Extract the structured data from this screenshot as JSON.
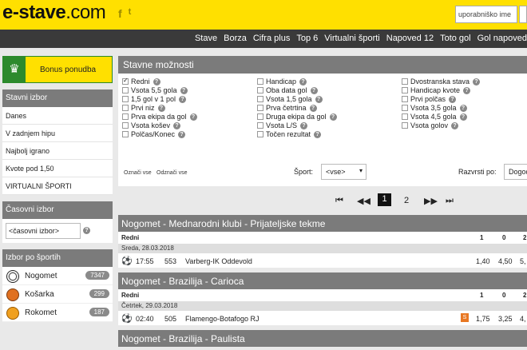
{
  "header": {
    "logo_main": "e-stave",
    "logo_domain": ".com",
    "social": [
      "f",
      "🐦"
    ],
    "login_placeholder": "uporabniško ime"
  },
  "nav": [
    "Stave",
    "Borza",
    "Cifra plus",
    "Top 6",
    "Virtualni športi",
    "Napoved 12",
    "Toto gol",
    "Gol napoved"
  ],
  "sidebar": {
    "bonus_label": "Bonus ponudba",
    "stavni_izbor_title": "Stavni izbor",
    "stavni_items": [
      "Danes",
      "V zadnjem hipu",
      "Najbolj igrano",
      "Kvote pod 1,50",
      "VIRTUALNI ŠPORTI"
    ],
    "casovni_title": "Časovni izbor",
    "casovni_value": "<časovni izbor>",
    "sport_title": "Izbor po športih",
    "sports": [
      {
        "name": "Nogomet",
        "count": "7347",
        "color": "#ffffff"
      },
      {
        "name": "Košarka",
        "count": "299",
        "color": "#e07020"
      },
      {
        "name": "Rokomet",
        "count": "187",
        "color": "#f0a020"
      }
    ]
  },
  "options": {
    "title": "Stavne možnosti",
    "col1": [
      {
        "label": "Redni",
        "checked": true
      },
      {
        "label": "Vsota 5,5 gola",
        "checked": false
      },
      {
        "label": "1,5 gol v 1 pol",
        "checked": false
      },
      {
        "label": "Prvi niz",
        "checked": false
      },
      {
        "label": "Prva ekipa da gol",
        "checked": false
      },
      {
        "label": "Vsota košev",
        "checked": false
      },
      {
        "label": "Polčas/Konec",
        "checked": false
      }
    ],
    "col2": [
      {
        "label": "Handicap",
        "checked": false
      },
      {
        "label": "Oba data gol",
        "checked": false
      },
      {
        "label": "Vsota 1,5 gola",
        "checked": false
      },
      {
        "label": "Prva četrtina",
        "checked": false
      },
      {
        "label": "Druga ekipa da gol",
        "checked": false
      },
      {
        "label": "Vsota L/S",
        "checked": false
      },
      {
        "label": "Točen rezultat",
        "checked": false
      }
    ],
    "col3": [
      {
        "label": "Dvostranska stava",
        "checked": false
      },
      {
        "label": "Handicap kvote",
        "checked": false
      },
      {
        "label": "Prvi polčas",
        "checked": false
      },
      {
        "label": "Vsota 3,5 gola",
        "checked": false
      },
      {
        "label": "Vsota 4,5 gola",
        "checked": false
      },
      {
        "label": "Vsota golov",
        "checked": false
      }
    ],
    "select_all": "Označi vse",
    "deselect_all": "Odznači vse",
    "sport_label": "Šport:",
    "sport_value": "<vse>",
    "sort_label": "Razvrsti po:",
    "sort_value": "Dogodku"
  },
  "pager": {
    "first": "⏮",
    "prev": "◀◀",
    "current": "1",
    "next_page": "2",
    "next": "▶▶",
    "last": "⏭"
  },
  "leagues": [
    {
      "title": "Nogomet - Mednarodni klubi - Prijateljske tekme",
      "type_label": "Redni",
      "cols": [
        "1",
        "0",
        "2"
      ],
      "date": "Sreda, 28.03.2018",
      "match": {
        "time": "17:55",
        "code": "553",
        "teams": "Varberg-IK Oddevold",
        "odds": [
          "1,40",
          "4,50",
          "5,"
        ],
        "badge": ""
      }
    },
    {
      "title": "Nogomet - Brazilija - Carioca",
      "type_label": "Redni",
      "cols": [
        "1",
        "0",
        "2"
      ],
      "date": "Četrtek, 29.03.2018",
      "match": {
        "time": "02:40",
        "code": "505",
        "teams": "Flamengo-Botafogo RJ",
        "odds": [
          "1,75",
          "3,25",
          "4,"
        ],
        "badge": "S"
      }
    },
    {
      "title": "Nogomet - Brazilija - Paulista"
    }
  ]
}
